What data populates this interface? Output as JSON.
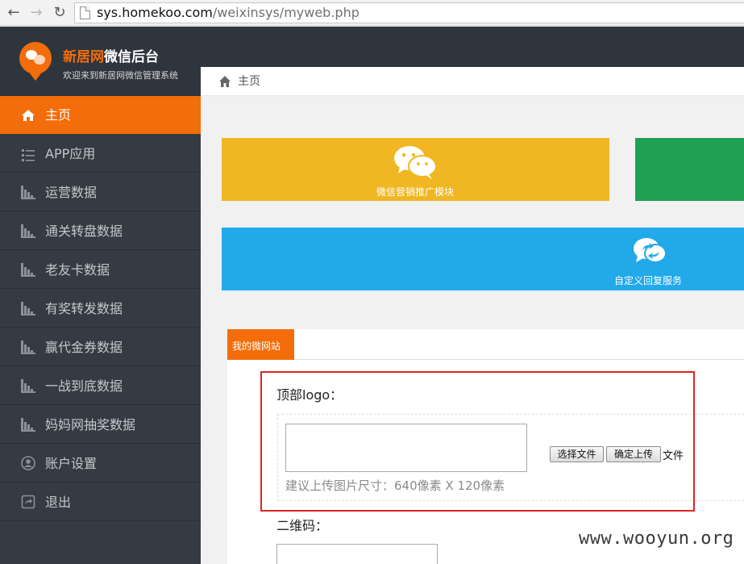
{
  "browser": {
    "url_host": "sys.homekoo.com",
    "url_path": "/weixinsys/myweb.php"
  },
  "header": {
    "brand_accent": "新居网",
    "brand_rest": "微信后台",
    "subtitle": "欢迎来到新居网微信管理系统"
  },
  "sidebar": {
    "items": [
      {
        "label": "主页",
        "icon": "home-icon"
      },
      {
        "label": "APP应用",
        "icon": "list-icon"
      },
      {
        "label": "运营数据",
        "icon": "bar-chart-icon"
      },
      {
        "label": "通关转盘数据",
        "icon": "bar-chart-icon"
      },
      {
        "label": "老友卡数据",
        "icon": "bar-chart-icon"
      },
      {
        "label": "有奖转发数据",
        "icon": "bar-chart-icon"
      },
      {
        "label": "赢代金券数据",
        "icon": "bar-chart-icon"
      },
      {
        "label": "一战到底数据",
        "icon": "bar-chart-icon"
      },
      {
        "label": "妈妈网抽奖数据",
        "icon": "bar-chart-icon"
      },
      {
        "label": "账户设置",
        "icon": "user-icon"
      },
      {
        "label": "退出",
        "icon": "logout-icon"
      }
    ]
  },
  "breadcrumb": {
    "home": "主页"
  },
  "tiles": {
    "wechat_marketing": "微信营销推广模块",
    "custom_reply": "自定义回复服务"
  },
  "panel": {
    "tab": "我的微网站",
    "logo_label": "顶部logo：",
    "choose_file": "选择文件",
    "confirm_upload": "确定上传",
    "file_status": "文件",
    "upload_hint": "建议上传图片尺寸：640像素 X 120像素",
    "qr_label": "二维码："
  },
  "watermark": "www.wooyun.org",
  "colors": {
    "accent": "#f36d0a",
    "sidebar_bg": "#353b42",
    "tile_yellow": "#f0b723",
    "tile_green": "#1fa053",
    "tile_blue": "#21a9ea",
    "highlight": "#e02424"
  }
}
